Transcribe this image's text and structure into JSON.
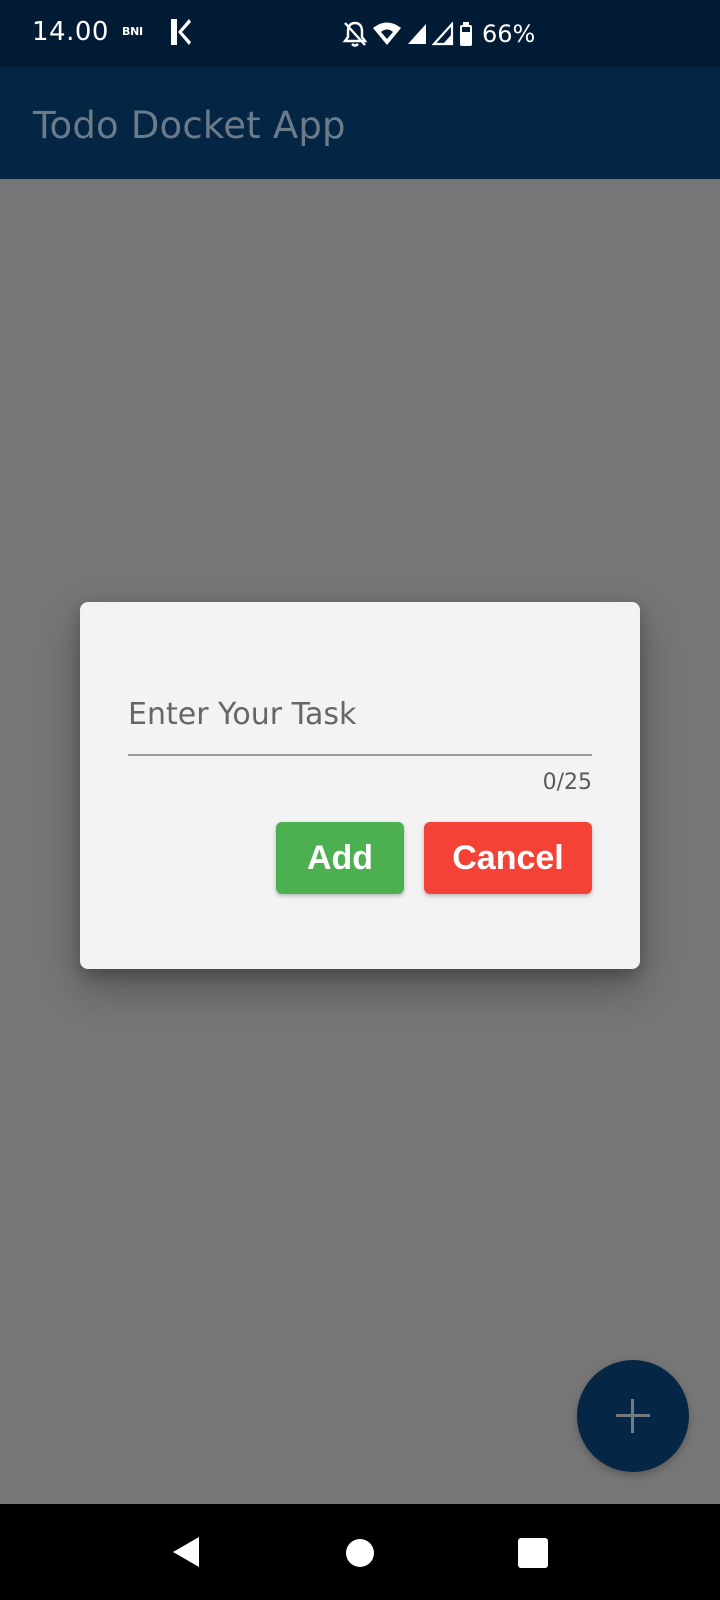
{
  "status_bar": {
    "time": "14.00",
    "carrier_badge": "BNI",
    "app_icon": "k-icon",
    "icons": [
      "bell-off-icon",
      "wifi-icon",
      "signal-icon",
      "signal-icon",
      "battery-icon"
    ],
    "battery": "66%"
  },
  "app_bar": {
    "title": "Todo Docket App"
  },
  "dialog": {
    "input_placeholder": "Enter Your Task",
    "input_value": "",
    "char_counter": "0/25",
    "add_label": "Add",
    "cancel_label": "Cancel",
    "add_color": "#4CAF50",
    "cancel_color": "#F44336"
  },
  "fab": {
    "icon": "plus-icon",
    "color": "#052644"
  },
  "nav_bar": {
    "icons": [
      "back-icon",
      "home-icon",
      "recents-icon"
    ]
  }
}
